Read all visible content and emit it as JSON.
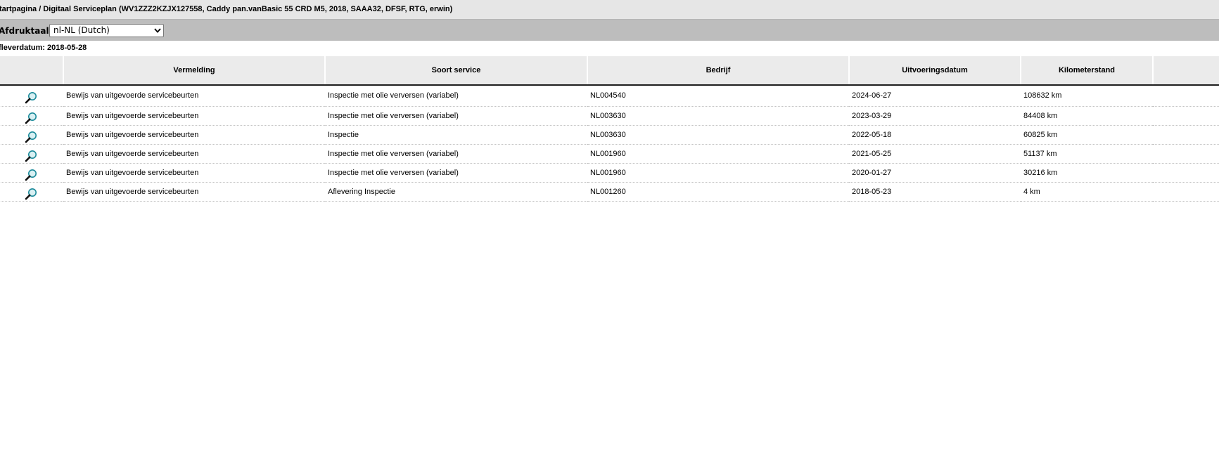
{
  "breadcrumb": "tartpagina / Digitaal Serviceplan (WV1ZZZ2KZJX127558, Caddy pan.vanBasic 55 CRD M5, 2018, SAAA32, DFSF, RTG, erwin)",
  "print_language": {
    "label": "Afdruktaal:",
    "selected": "nl-NL (Dutch)"
  },
  "delivery": {
    "label": "fleverdatum:",
    "value": "2018-05-28"
  },
  "table": {
    "columns": [
      "",
      "Vermelding",
      "Soort service",
      "Bedrijf",
      "Uitvoeringsdatum",
      "Kilometerstand",
      ""
    ],
    "rows": [
      {
        "vermelding": "Bewijs van uitgevoerde servicebeurten",
        "soort": "Inspectie met olie verversen (variabel)",
        "bedrijf": "NL004540",
        "datum": "2024-06-27",
        "km": "108632 km"
      },
      {
        "vermelding": "Bewijs van uitgevoerde servicebeurten",
        "soort": "Inspectie met olie verversen (variabel)",
        "bedrijf": "NL003630",
        "datum": "2023-03-29",
        "km": "84408 km"
      },
      {
        "vermelding": "Bewijs van uitgevoerde servicebeurten",
        "soort": "Inspectie",
        "bedrijf": "NL003630",
        "datum": "2022-05-18",
        "km": "60825 km"
      },
      {
        "vermelding": "Bewijs van uitgevoerde servicebeurten",
        "soort": "Inspectie met olie verversen (variabel)",
        "bedrijf": "NL001960",
        "datum": "2021-05-25",
        "km": "51137 km"
      },
      {
        "vermelding": "Bewijs van uitgevoerde servicebeurten",
        "soort": "Inspectie met olie verversen (variabel)",
        "bedrijf": "NL001960",
        "datum": "2020-01-27",
        "km": "30216 km"
      },
      {
        "vermelding": "Bewijs van uitgevoerde servicebeurten",
        "soort": "Aflevering Inspectie",
        "bedrijf": "NL001260",
        "datum": "2018-05-23",
        "km": "4 km"
      }
    ]
  },
  "icons": {
    "row_action": "magnifier-icon",
    "select_arrow": "chevron-down-icon"
  },
  "colors": {
    "breadcrumb_bg": "#e6e6e6",
    "language_bar_bg": "#bdbdbd",
    "header_bg": "#ebebeb",
    "magnifier_lens": "#1b8a9a"
  }
}
